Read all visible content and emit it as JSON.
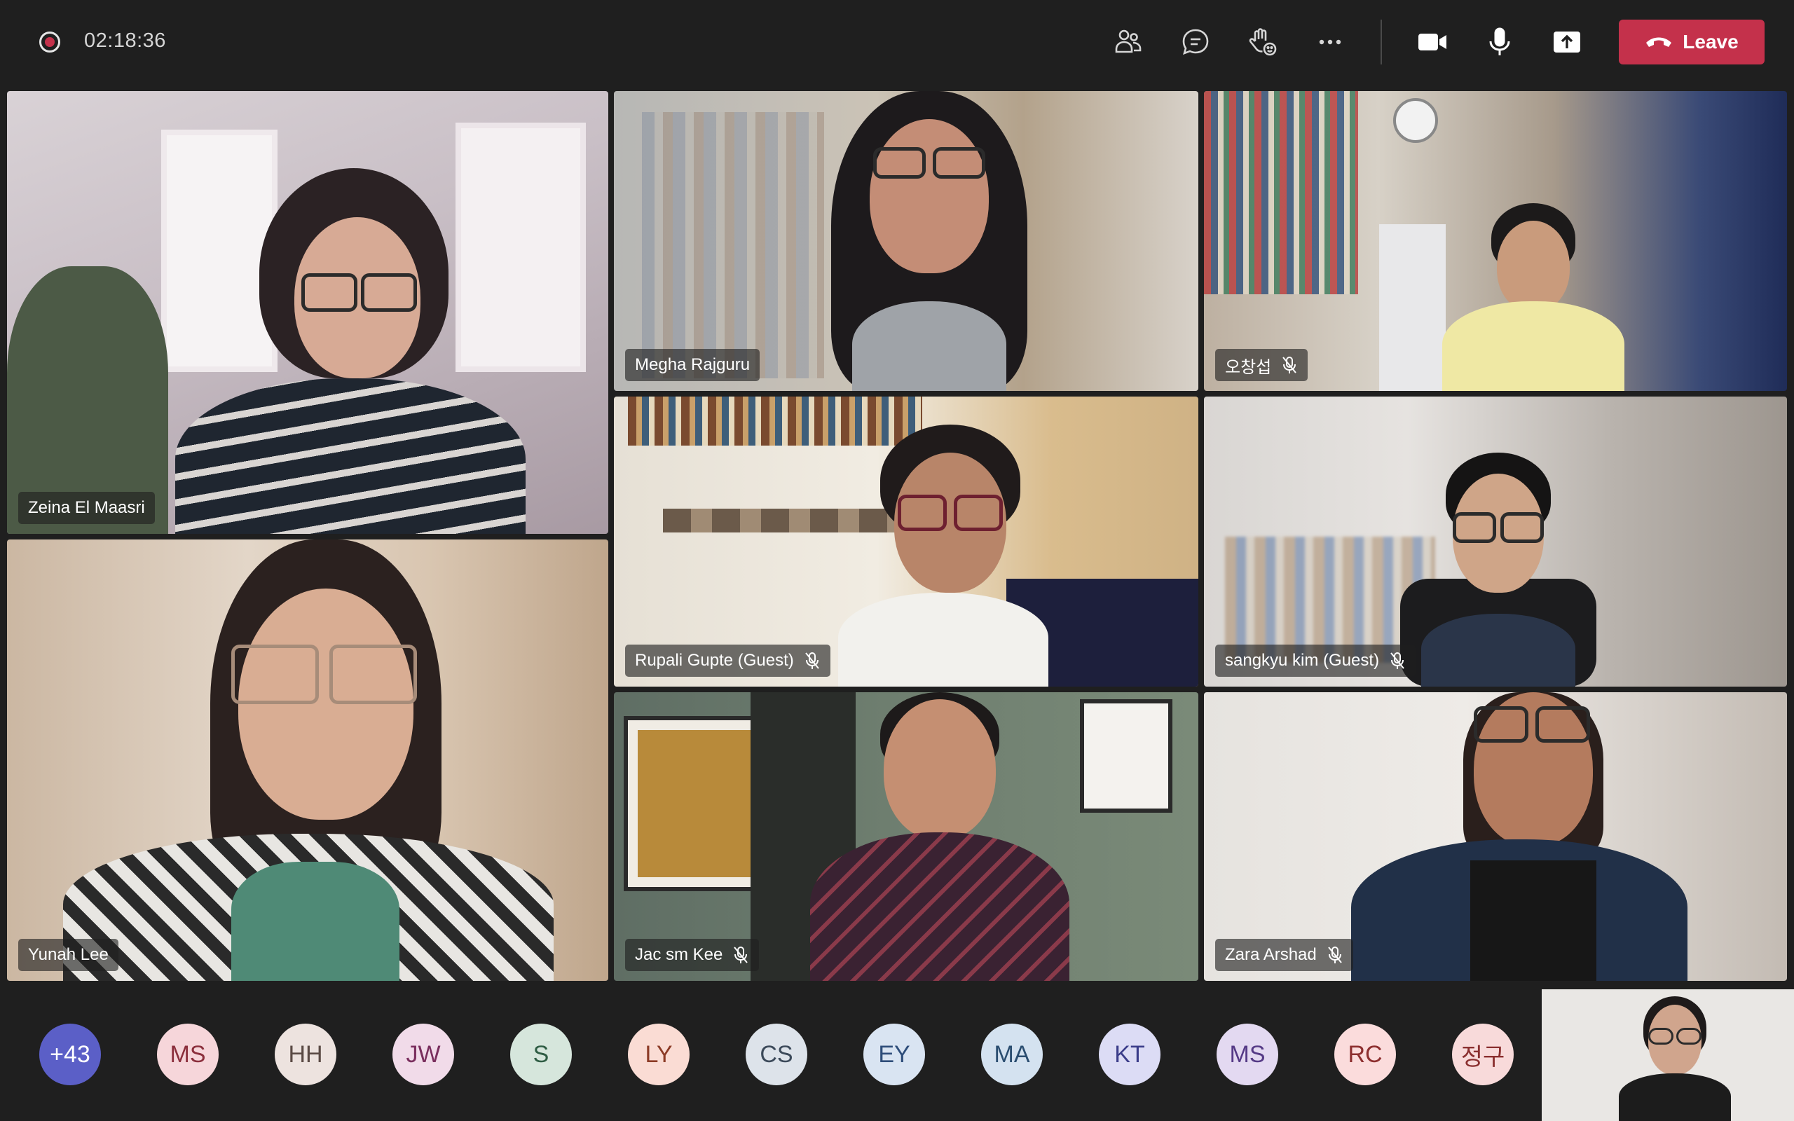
{
  "meeting": {
    "timer": "02:18:36"
  },
  "toolbar": {
    "participants_icon": "people-icon",
    "chat_icon": "chat-icon",
    "reactions_icon": "raise-hand-icon",
    "more_icon": "more-icon",
    "camera_icon": "camera-icon",
    "mic_icon": "microphone-icon",
    "share_icon": "share-icon",
    "leave_label": "Leave",
    "colors": {
      "leave_bg": "#c4314b",
      "bar_bg": "#1f1f1f"
    }
  },
  "participants": [
    {
      "name": "Zeina El Maasri",
      "muted": false
    },
    {
      "name": "Megha Rajguru",
      "muted": false
    },
    {
      "name": "오창섭",
      "muted": true
    },
    {
      "name": "Rupali Gupte (Guest)",
      "muted": true
    },
    {
      "name": "sangkyu kim (Guest)",
      "muted": true
    },
    {
      "name": "Yunah Lee",
      "muted": false
    },
    {
      "name": "Jac sm Kee",
      "muted": true
    },
    {
      "name": "Zara Arshad",
      "muted": true
    }
  ],
  "avatars": [
    {
      "initials": "+43",
      "bg": "#5b5fc7",
      "fg": "#ffffff"
    },
    {
      "initials": "MS",
      "bg": "#f6d6da",
      "fg": "#8b2f3c"
    },
    {
      "initials": "HH",
      "bg": "#ede3df",
      "fg": "#5a4a44"
    },
    {
      "initials": "JW",
      "bg": "#f1dbe9",
      "fg": "#7a2f5e"
    },
    {
      "initials": "S",
      "bg": "#d6e6dc",
      "fg": "#2f5d44"
    },
    {
      "initials": "LY",
      "bg": "#fadcd4",
      "fg": "#8c3b26"
    },
    {
      "initials": "CS",
      "bg": "#dde3ea",
      "fg": "#3c4a5a"
    },
    {
      "initials": "EY",
      "bg": "#d9e4f2",
      "fg": "#2e4d7a"
    },
    {
      "initials": "MA",
      "bg": "#d4e2f0",
      "fg": "#2a4d70"
    },
    {
      "initials": "KT",
      "bg": "#dcdcf5",
      "fg": "#3b3d8a"
    },
    {
      "initials": "MS",
      "bg": "#e3d9f1",
      "fg": "#553a86"
    },
    {
      "initials": "RC",
      "bg": "#fbdcdc",
      "fg": "#8d2f2f"
    },
    {
      "initials": "정구",
      "bg": "#f8dada",
      "fg": "#8a2f2f"
    }
  ]
}
